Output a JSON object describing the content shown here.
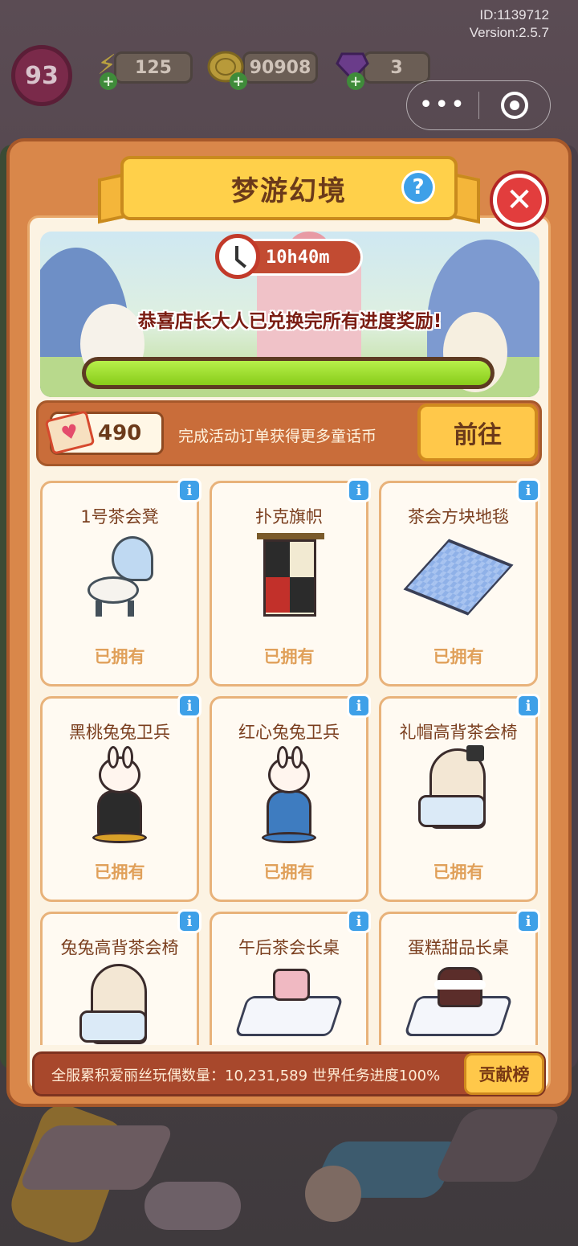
{
  "status": {
    "id_text": "ID:1139712",
    "version_text": "Version:2.5.7",
    "level": "93",
    "energy": "125",
    "coins": "90908",
    "gems": "3"
  },
  "colors": {
    "panel": "#d9874a",
    "accent": "#ffc84a",
    "progress": "#9ee030",
    "close": "#e23d3d",
    "info": "#3ea0e8"
  },
  "icons": {
    "energy": "lightning-icon",
    "coins": "coin-icon",
    "gems": "gem-icon",
    "more": "more-dots-icon",
    "target": "target-icon",
    "help": "question-icon",
    "close": "close-icon",
    "clock": "clock-icon",
    "card": "heart-card-icon",
    "info": "info-icon"
  },
  "dialog": {
    "title": "梦游幻境",
    "help_label": "?",
    "close_label": "✕",
    "timer": "10h40m",
    "congrats": "恭喜店长大人已兑换完所有进度奖励!",
    "progress_fraction": 1.0
  },
  "coin_row": {
    "value": "490",
    "description": "完成活动订单获得更多童话币",
    "go_label": "前往"
  },
  "items": [
    {
      "name": "1号茶会凳",
      "status": "已拥有",
      "info": "i"
    },
    {
      "name": "扑克旗帜",
      "status": "已拥有",
      "info": "i"
    },
    {
      "name": "茶会方块地毯",
      "status": "已拥有",
      "info": "i"
    },
    {
      "name": "黑桃兔兔卫兵",
      "status": "已拥有",
      "info": "i"
    },
    {
      "name": "红心兔兔卫兵",
      "status": "已拥有",
      "info": "i"
    },
    {
      "name": "礼帽高背茶会椅",
      "status": "已拥有",
      "info": "i"
    },
    {
      "name": "兔兔高背茶会椅",
      "status": "",
      "info": "i"
    },
    {
      "name": "午后茶会长桌",
      "status": "",
      "info": "i"
    },
    {
      "name": "蛋糕甜品长桌",
      "status": "",
      "info": "i"
    }
  ],
  "footer": {
    "stats_text": "全服累积爱丽丝玩偶数量：10,231,589  世界任务进度100%",
    "rank_label": "贡献榜"
  }
}
